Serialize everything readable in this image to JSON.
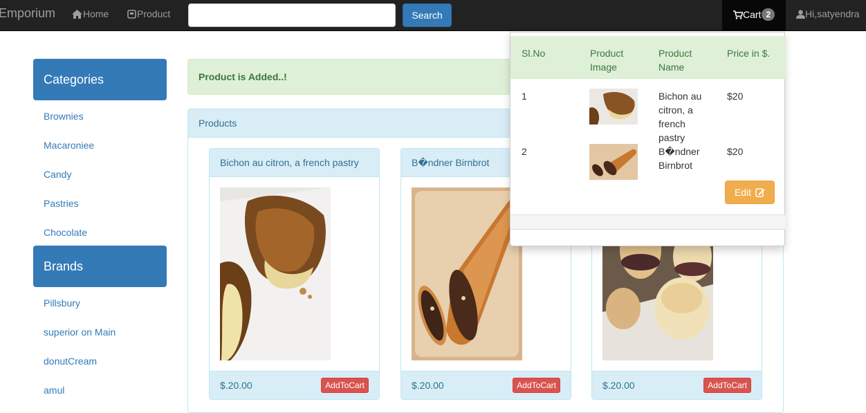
{
  "navbar": {
    "brand": "Emporium",
    "home_label": "Home",
    "product_label": "Product",
    "search_placeholder": "",
    "search_button": "Search",
    "cart_label": "Cart",
    "cart_count": "2",
    "user_label": "Hi,satyendra"
  },
  "sidebar": {
    "categories_title": "Categories",
    "categories": [
      "Brownies",
      "Macaroniee",
      "Candy",
      "Pastries",
      "Chocolate"
    ],
    "brands_title": "Brands",
    "brands": [
      "Pillsbury",
      "superior on Main",
      "donutCream",
      "amul"
    ]
  },
  "alert": {
    "text": "Product is Added..!"
  },
  "products_panel": {
    "title": "Products",
    "items": [
      {
        "name": "Bichon au citron, a french pastry",
        "price": "$.20.00",
        "button": "AddToCart"
      },
      {
        "name": "B�ndner Birnbrot",
        "price": "$.20.00",
        "button": "AddToCart"
      },
      {
        "name": "",
        "price": "$.20.00",
        "button": "AddToCart"
      }
    ]
  },
  "cart_dropdown": {
    "headers": {
      "slno": "Sl.No",
      "image_1": "Product",
      "image_2": "Image",
      "name_1": "Product",
      "name_2": "Name",
      "price": "Price in $."
    },
    "rows": [
      {
        "slno": "1",
        "name_lines": [
          "Bichon au",
          "citron, a",
          "french",
          "pastry"
        ],
        "price": "$20"
      },
      {
        "slno": "2",
        "name_lines": [
          "B�ndner",
          "Birnbrot"
        ],
        "price": "$20"
      }
    ],
    "edit_label": "Edit"
  },
  "colors": {
    "navbar": "#222222",
    "primary": "#337ab7",
    "success_bg": "#dff0d8",
    "info_bg": "#d9edf7",
    "danger": "#d9534f",
    "warning": "#f0ad4e"
  }
}
